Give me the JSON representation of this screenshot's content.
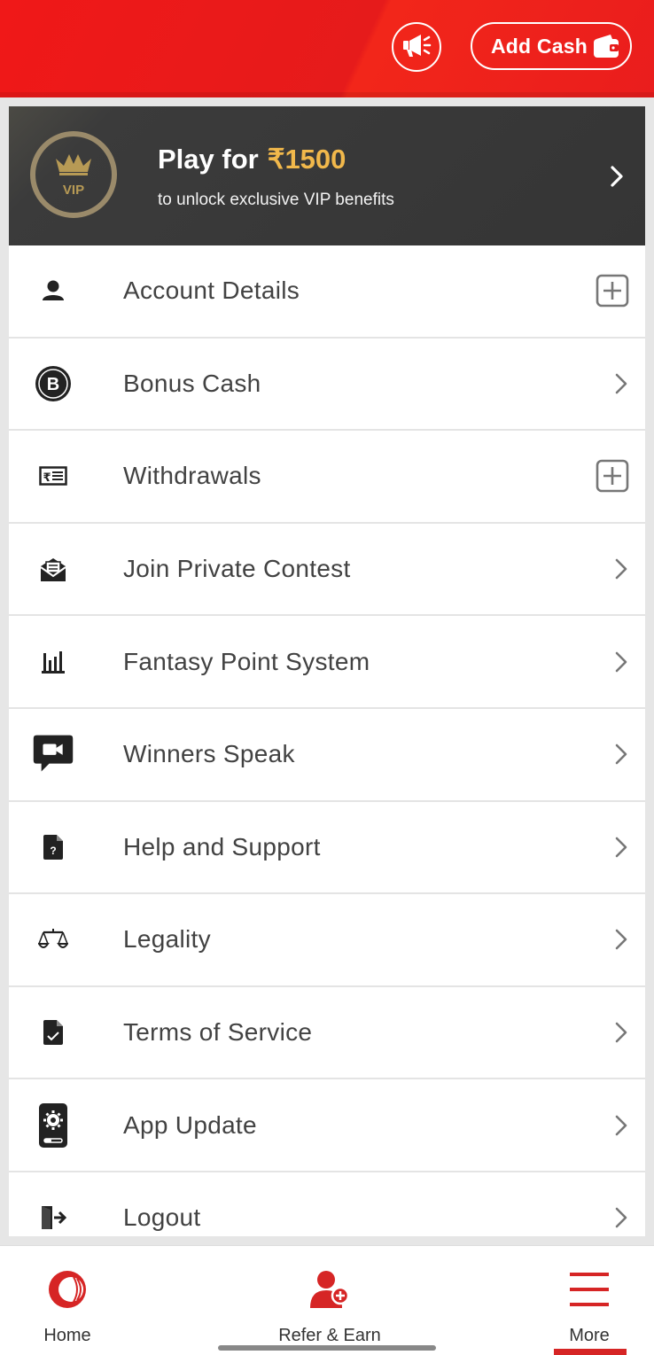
{
  "header": {
    "announcement_icon": "megaphone-icon",
    "add_cash_label": "Add Cash",
    "wallet_icon": "wallet-icon"
  },
  "vip_banner": {
    "badge_text": "VIP",
    "title_prefix": "Play for",
    "amount": "₹1500",
    "subtitle": "to unlock exclusive VIP benefits",
    "colors": {
      "amount": "#f1b84b",
      "background": "#353535"
    }
  },
  "menu": {
    "items": [
      {
        "label": "Account Details",
        "icon": "user-icon",
        "action": "expand"
      },
      {
        "label": "Bonus Cash",
        "icon": "bonus-b-icon",
        "action": "chevron"
      },
      {
        "label": "Withdrawals",
        "icon": "rupee-note-icon",
        "action": "expand"
      },
      {
        "label": "Join Private Contest",
        "icon": "envelope-icon",
        "action": "chevron"
      },
      {
        "label": "Fantasy Point System",
        "icon": "bar-chart-icon",
        "action": "chevron"
      },
      {
        "label": "Winners Speak",
        "icon": "video-chat-icon",
        "action": "chevron"
      },
      {
        "label": "Help and Support",
        "icon": "help-document-icon",
        "action": "chevron"
      },
      {
        "label": "Legality",
        "icon": "scales-icon",
        "action": "chevron"
      },
      {
        "label": "Terms of Service",
        "icon": "document-check-icon",
        "action": "chevron"
      },
      {
        "label": "App Update",
        "icon": "phone-settings-icon",
        "action": "chevron"
      },
      {
        "label": "Logout",
        "icon": "logout-icon",
        "action": "chevron"
      }
    ]
  },
  "bottom_nav": {
    "items": [
      {
        "label": "Home",
        "icon": "cricket-ball-icon",
        "active": false
      },
      {
        "label": "Refer & Earn",
        "icon": "refer-user-icon",
        "active": false
      },
      {
        "label": "More",
        "icon": "hamburger-menu-icon",
        "active": true
      }
    ]
  },
  "colors": {
    "brand_red": "#e61b1b",
    "accent_red": "#d62525",
    "text": "#424242"
  }
}
